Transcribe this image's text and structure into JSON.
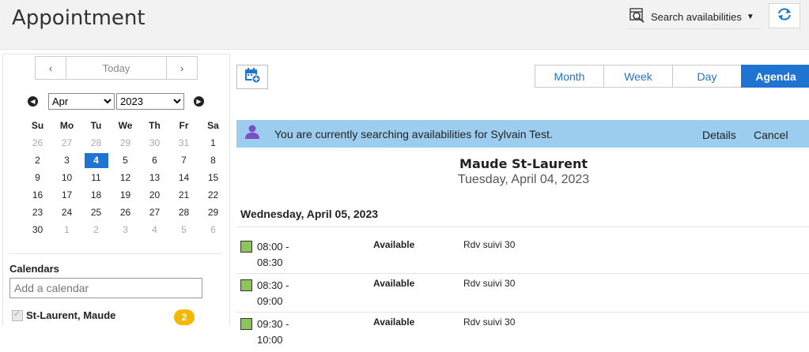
{
  "header": {
    "title": "Appointment",
    "search_label": "Search availabilities",
    "search_icon": "search-calendar-icon",
    "refresh_icon": "refresh-icon"
  },
  "mini_calendar": {
    "prev": "‹",
    "today": "Today",
    "next": "›",
    "month": "Apr",
    "year": "2023",
    "weekdays": [
      "Su",
      "Mo",
      "Tu",
      "We",
      "Th",
      "Fr",
      "Sa"
    ],
    "weeks": [
      [
        "26",
        "27",
        "28",
        "29",
        "30",
        "31",
        "1"
      ],
      [
        "2",
        "3",
        "4",
        "5",
        "6",
        "7",
        "8"
      ],
      [
        "9",
        "10",
        "11",
        "12",
        "13",
        "14",
        "15"
      ],
      [
        "16",
        "17",
        "18",
        "19",
        "20",
        "21",
        "22"
      ],
      [
        "23",
        "24",
        "25",
        "26",
        "27",
        "28",
        "29"
      ],
      [
        "30",
        "1",
        "2",
        "3",
        "4",
        "5",
        "6"
      ]
    ],
    "selected": "4"
  },
  "calendars": {
    "title": "Calendars",
    "add_placeholder": "Add a calendar",
    "items": [
      {
        "label": "St-Laurent, Maude",
        "count": "2"
      }
    ]
  },
  "views": {
    "month": "Month",
    "week": "Week",
    "day": "Day",
    "agenda": "Agenda",
    "active": "Agenda"
  },
  "banner": {
    "message": "You are currently searching availabilities for Sylvain Test.",
    "details": "Details",
    "cancel": "Cancel",
    "color": "#9dcdee"
  },
  "agenda": {
    "person": "Maude St-Laurent",
    "date": "Tuesday, April 04, 2023",
    "day_heading": "Wednesday, April 05, 2023",
    "slots": [
      {
        "time": "08:00 - 08:30",
        "status": "Available",
        "type": "Rdv suivi 30"
      },
      {
        "time": "08:30 - 09:00",
        "status": "Available",
        "type": "Rdv suivi 30"
      },
      {
        "time": "09:30 - 10:00",
        "status": "Available",
        "type": "Rdv suivi 30"
      }
    ]
  },
  "colors": {
    "accent": "#1f73d1",
    "available": "#8dc55a",
    "badge": "#f5b800"
  }
}
